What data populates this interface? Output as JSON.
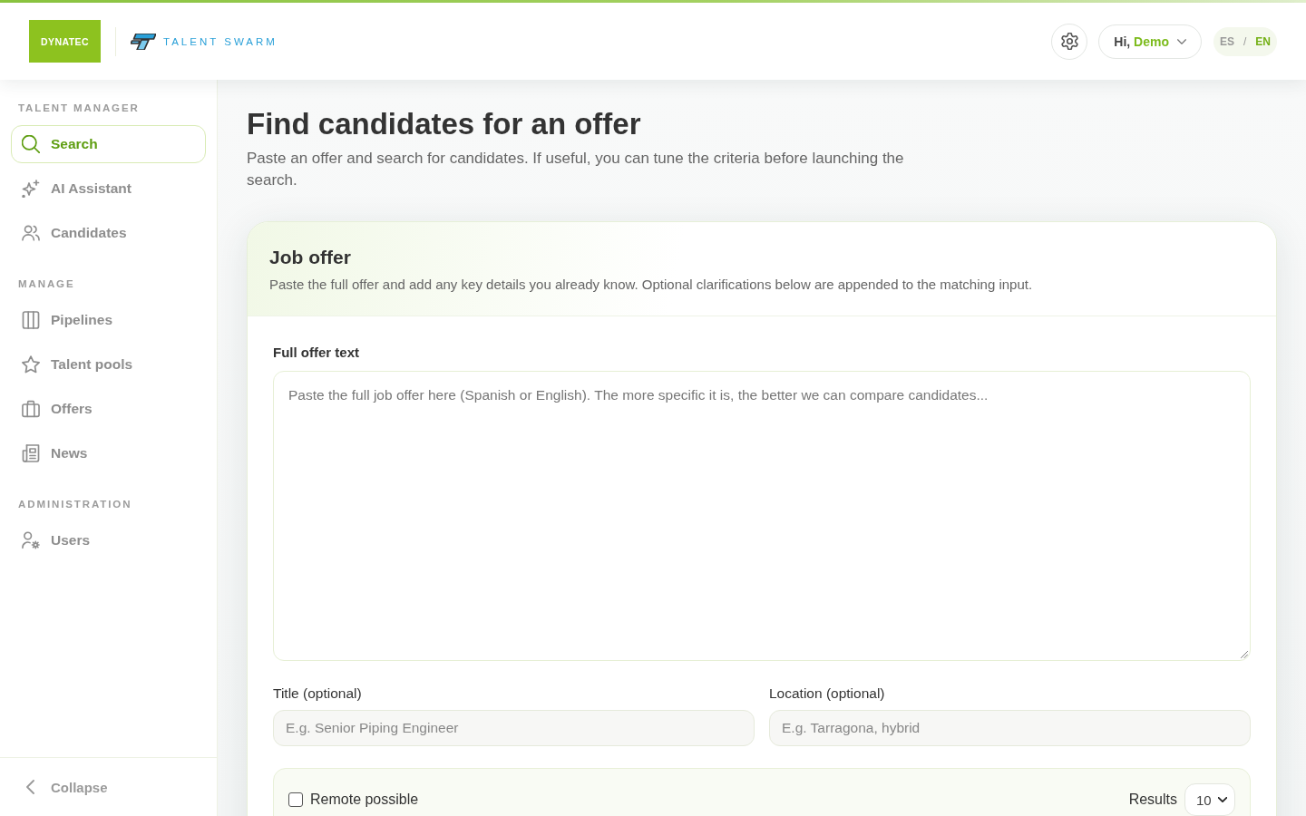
{
  "header": {
    "brand": {
      "name": "DYNATEC"
    },
    "product": {
      "name": "TALENT SWARM"
    },
    "user_menu": {
      "greeting": "Hi,",
      "name": "Demo"
    },
    "language_switch": {
      "languages": [
        {
          "code": "ES",
          "selected": false
        },
        {
          "code": "EN",
          "selected": true
        }
      ],
      "separator": "/"
    }
  },
  "sidebar": {
    "sections": [
      {
        "title": "TALENT MANAGER",
        "items": [
          {
            "label": "Search",
            "selected": true
          },
          {
            "label": "AI Assistant",
            "selected": false
          },
          {
            "label": "Candidates",
            "selected": false
          }
        ]
      },
      {
        "title": "MANAGE",
        "items": [
          {
            "label": "Pipelines",
            "selected": false
          },
          {
            "label": "Talent pools",
            "selected": false
          },
          {
            "label": "Offers",
            "selected": false
          },
          {
            "label": "News",
            "selected": false
          }
        ]
      },
      {
        "title": "ADMINISTRATION",
        "items": [
          {
            "label": "Users",
            "selected": false
          }
        ]
      }
    ],
    "collapse": {
      "label": "Collapse"
    }
  },
  "page": {
    "title": "Find candidates for an offer",
    "subtitle": "Paste an offer and search for candidates. If useful, you can tune the criteria before launching the search."
  },
  "job_offer": {
    "title": "Job offer",
    "description": "Paste the full offer and add any key details you already know. Optional clarifications below are appended to the matching input.",
    "offer_text": {
      "label": "Full offer text",
      "placeholder": "Paste the full job offer here (Spanish or English). The more specific it is, the better we can compare candidates..."
    },
    "fields": [
      {
        "label": "Title (optional)",
        "placeholder": "E.g. Senior Piping Engineer"
      },
      {
        "label": "Location (optional)",
        "placeholder": "E.g. Tarragona, hybrid"
      }
    ],
    "remote": {
      "label": "Remote possible",
      "checked": false
    },
    "results": {
      "label": "Results",
      "value": "10"
    }
  }
}
